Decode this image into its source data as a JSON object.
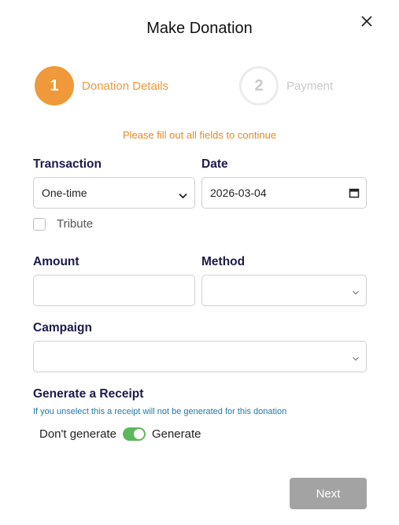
{
  "modal": {
    "title": "Make Donation"
  },
  "steps": [
    {
      "number": "1",
      "label": "Donation Details"
    },
    {
      "number": "2",
      "label": "Payment"
    }
  ],
  "notice": "Please fill out all fields to continue",
  "transaction": {
    "label": "Transaction",
    "value": "One-time"
  },
  "date": {
    "label": "Date",
    "value": "2026-03-04"
  },
  "tribute": {
    "label": "Tribute"
  },
  "amount": {
    "label": "Amount",
    "value": ""
  },
  "method": {
    "label": "Method",
    "value": ""
  },
  "campaign": {
    "label": "Campaign",
    "value": ""
  },
  "receipt": {
    "title": "Generate a Receipt",
    "help": "If you unselect this a receipt will not be generated for this donation",
    "off_label": "Don't generate",
    "on_label": "Generate"
  },
  "next_button": "Next",
  "colors": {
    "accent": "#f0993a",
    "toggle_on": "#5cb85c",
    "heading": "#1c1a4a",
    "help_text": "#1f7aa8"
  },
  "icons": [
    "close-icon",
    "chevron-down-icon",
    "caret-down-icon",
    "calendar-icon"
  ]
}
